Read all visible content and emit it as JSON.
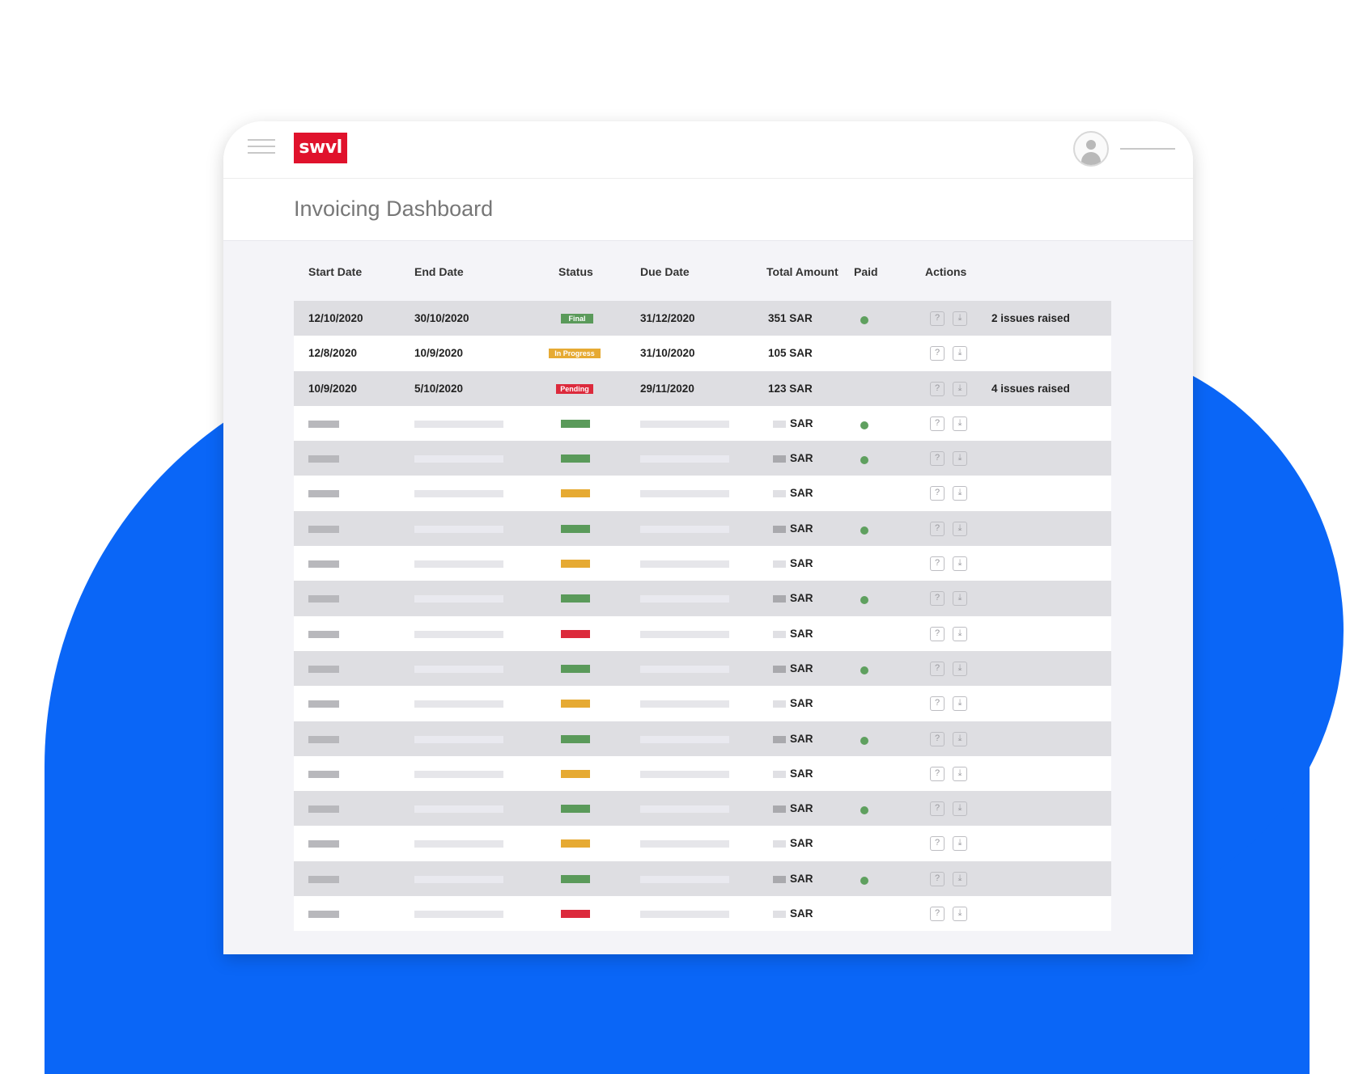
{
  "app": {
    "logo_text": "swvl",
    "page_title": "Invoicing Dashboard"
  },
  "icons": {
    "menu": "hamburger-icon",
    "avatar": "user-avatar-icon",
    "help": "question-icon",
    "download": "download-icon"
  },
  "colors": {
    "brand": "#e0122c",
    "background_shape": "#0a66f7",
    "status_final": "#5a9a5a",
    "status_in_progress": "#e6aa33",
    "status_pending": "#dc2a3c",
    "paid_dot": "#5fa05f"
  },
  "table": {
    "headers": {
      "start_date": "Start Date",
      "end_date": "End Date",
      "status": "Status",
      "due_date": "Due Date",
      "total_amount": "Total Amount",
      "paid": "Paid",
      "actions": "Actions"
    },
    "detailed_rows": [
      {
        "start": "12/10/2020",
        "end": "30/10/2020",
        "status": "Final",
        "status_key": "final",
        "due": "31/12/2020",
        "amount": "351 SAR",
        "paid": true,
        "issues": "2 issues raised"
      },
      {
        "start": "12/8/2020",
        "end": "10/9/2020",
        "status": "In Progress",
        "status_key": "in_progress",
        "due": "31/10/2020",
        "amount": "105 SAR",
        "paid": false,
        "issues": ""
      },
      {
        "start": "10/9/2020",
        "end": "5/10/2020",
        "status": "Pending",
        "status_key": "pending",
        "due": "29/11/2020",
        "amount": "123 SAR",
        "paid": false,
        "issues": "4 issues raised"
      }
    ],
    "placeholder_rows": [
      {
        "status_key": "final",
        "paid": true,
        "amount_unit": "SAR"
      },
      {
        "status_key": "final",
        "paid": true,
        "amount_unit": "SAR"
      },
      {
        "status_key": "in_progress",
        "paid": false,
        "amount_unit": "SAR"
      },
      {
        "status_key": "final",
        "paid": true,
        "amount_unit": "SAR"
      },
      {
        "status_key": "in_progress",
        "paid": false,
        "amount_unit": "SAR"
      },
      {
        "status_key": "final",
        "paid": true,
        "amount_unit": "SAR"
      },
      {
        "status_key": "pending",
        "paid": false,
        "amount_unit": "SAR"
      },
      {
        "status_key": "final",
        "paid": true,
        "amount_unit": "SAR"
      },
      {
        "status_key": "in_progress",
        "paid": false,
        "amount_unit": "SAR"
      },
      {
        "status_key": "final",
        "paid": true,
        "amount_unit": "SAR"
      },
      {
        "status_key": "in_progress",
        "paid": false,
        "amount_unit": "SAR"
      },
      {
        "status_key": "final",
        "paid": true,
        "amount_unit": "SAR"
      },
      {
        "status_key": "in_progress",
        "paid": false,
        "amount_unit": "SAR"
      },
      {
        "status_key": "final",
        "paid": true,
        "amount_unit": "SAR"
      },
      {
        "status_key": "pending",
        "paid": false,
        "amount_unit": "SAR"
      }
    ]
  }
}
